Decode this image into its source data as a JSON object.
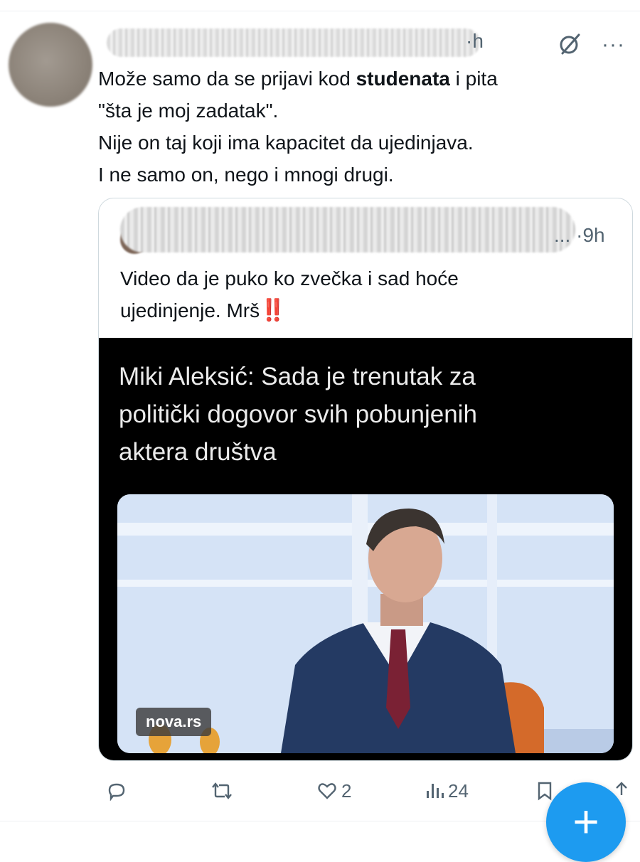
{
  "tweet": {
    "time": "·h",
    "text_lines": [
      {
        "before": "Može samo da se prijavi kod ",
        "bold": "studenata",
        "after": " i pita"
      },
      {
        "text": "\"šta je moj zadatak\"."
      },
      {
        "text": "Nije on taj koji ima kapacitet da ujedinjava."
      },
      {
        "text": "I ne samo on, nego i mnogi drugi."
      }
    ]
  },
  "quote": {
    "time": "... ·9h",
    "text_line1": "Video da je puko ko zvečka i sad hoće",
    "text_line2": "ujedinjenje. Mrš",
    "emoji": "‼️",
    "card": {
      "headline_lines": [
        "Miki Aleksić: Sada je trenutak za",
        "politički dogovor svih pobunjenih",
        "aktera društva"
      ],
      "source_badge": "nova.rs"
    }
  },
  "actions": {
    "replies_icon": "reply-icon",
    "retweets_icon": "retweet-icon",
    "likes": "2",
    "views": "24",
    "bookmark_icon": "bookmark-icon",
    "share_icon": "share-icon"
  },
  "fab": {
    "label": "+",
    "color": "#1d9bf0"
  }
}
